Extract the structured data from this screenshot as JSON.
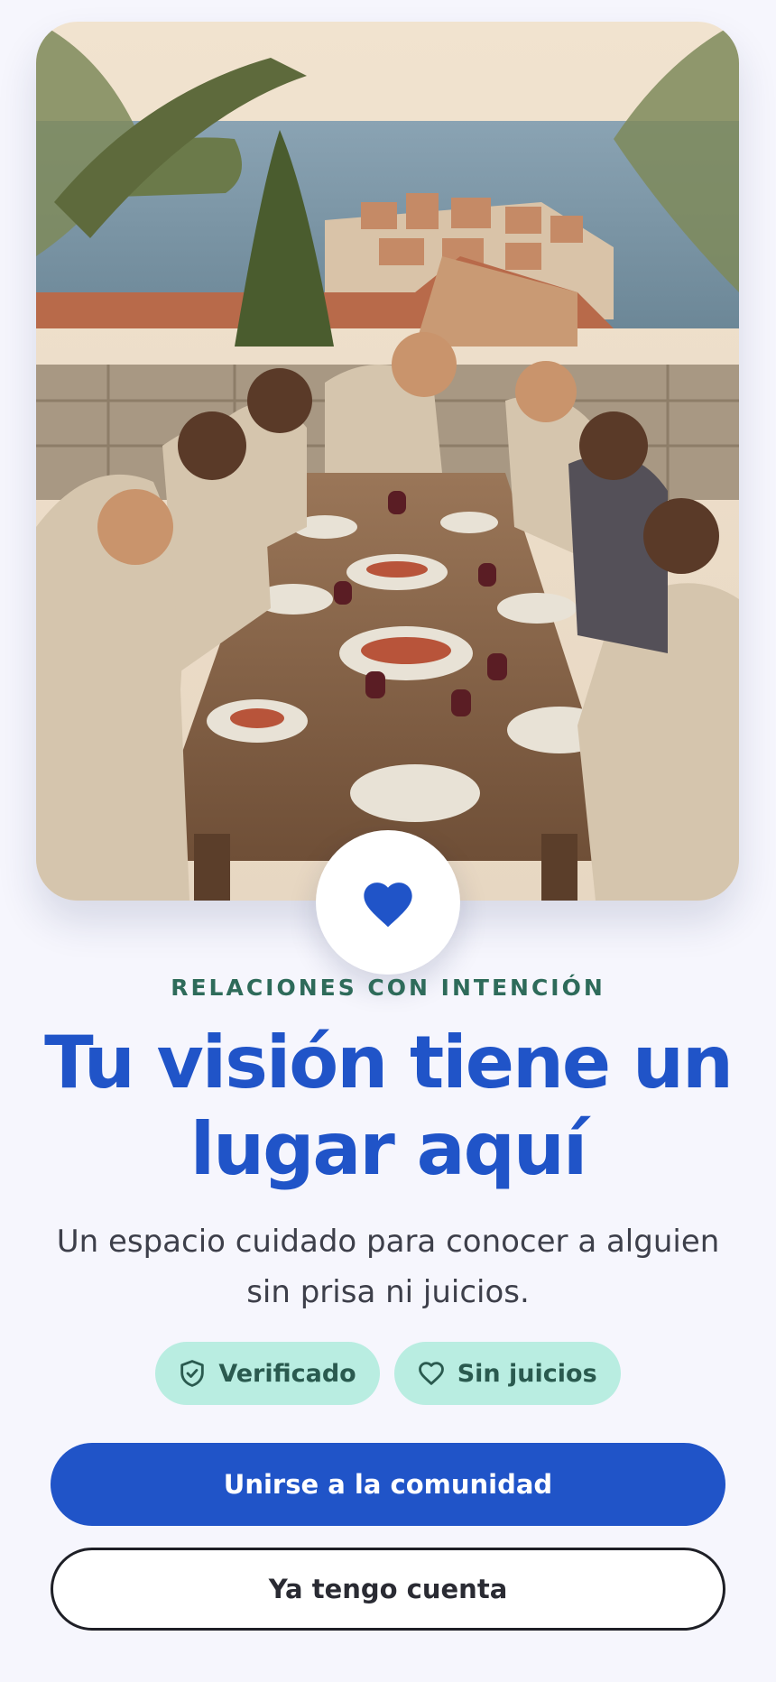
{
  "hero": {
    "image_description": "Group of friends sharing a meal at a long wooden table on a terrace overlooking a coastal old town and the sea"
  },
  "badge": {
    "icon": "heart-icon",
    "color": "#2054c8"
  },
  "kicker": "RELACIONES CON INTENCIÓN",
  "title": "Tu visión tiene un lugar aquí",
  "subtitle": "Un espacio cuidado para conocer a alguien sin prisa ni juicios.",
  "chips": [
    {
      "icon": "shield-check-icon",
      "label": "Verificado"
    },
    {
      "icon": "heart-outline-icon",
      "label": "Sin juicios"
    }
  ],
  "buttons": {
    "primary": "Unirse a la comunidad",
    "secondary": "Ya tengo cuenta"
  },
  "colors": {
    "accent": "#2054c8",
    "kicker": "#2e6b5a",
    "chip_bg": "#b9ede1",
    "chip_text": "#2a5a4f",
    "background": "#f6f6fd"
  }
}
